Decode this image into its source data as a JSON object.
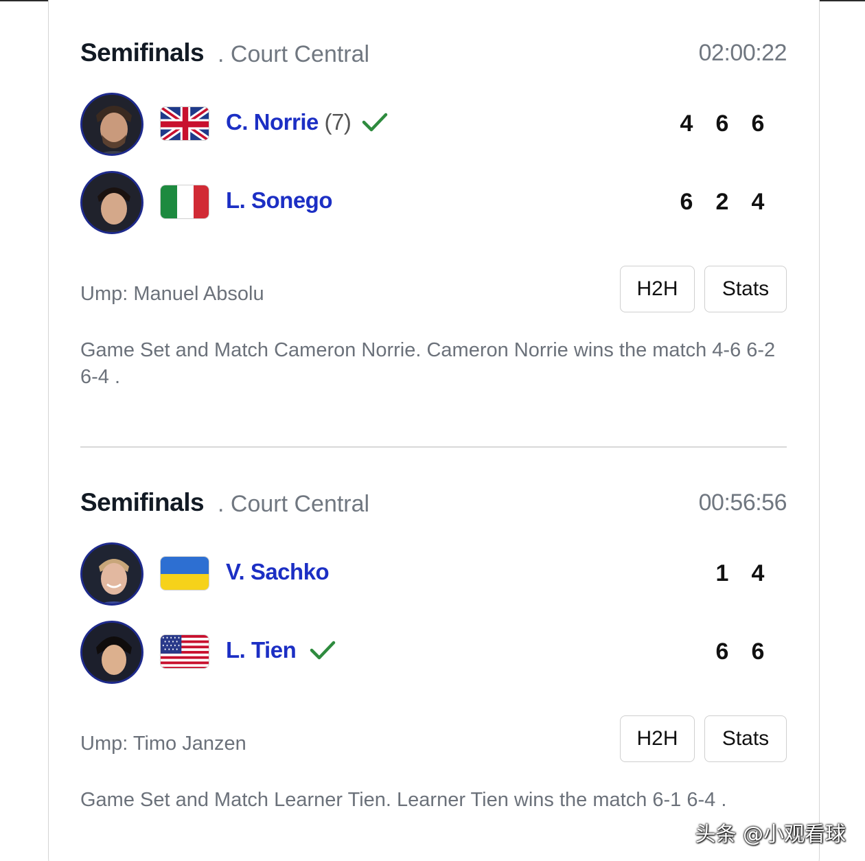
{
  "matches": [
    {
      "round": "Semifinals",
      "court": ". Court Central",
      "duration": "02:00:22",
      "players": [
        {
          "name": "C. Norrie",
          "seed": "(7)",
          "country": "GBR",
          "winner": true,
          "scores": [
            "4",
            "6",
            "6"
          ]
        },
        {
          "name": "L. Sonego",
          "seed": "",
          "country": "ITA",
          "winner": false,
          "scores": [
            "6",
            "2",
            "4"
          ]
        }
      ],
      "umpire": "Ump: Manuel Absolu",
      "h2h_label": "H2H",
      "stats_label": "Stats",
      "summary": "Game Set and Match Cameron Norrie. Cameron Norrie wins the match 4-6 6-2 6-4 ."
    },
    {
      "round": "Semifinals",
      "court": ". Court Central",
      "duration": "00:56:56",
      "players": [
        {
          "name": "V. Sachko",
          "seed": "",
          "country": "UKR",
          "winner": false,
          "scores": [
            "1",
            "4"
          ]
        },
        {
          "name": "L. Tien",
          "seed": "",
          "country": "USA",
          "winner": true,
          "scores": [
            "6",
            "6"
          ]
        }
      ],
      "umpire": "Ump: Timo Janzen",
      "h2h_label": "H2H",
      "stats_label": "Stats",
      "summary": "Game Set and Match Learner Tien. Learner Tien wins the match 6-1 6-4 ."
    }
  ],
  "watermark": "头条 @小观看球",
  "colors": {
    "player_link": "#1c2fc4",
    "check": "#2e8b3e",
    "avatar_border": "#1e2a8c",
    "muted": "#6b717a"
  }
}
